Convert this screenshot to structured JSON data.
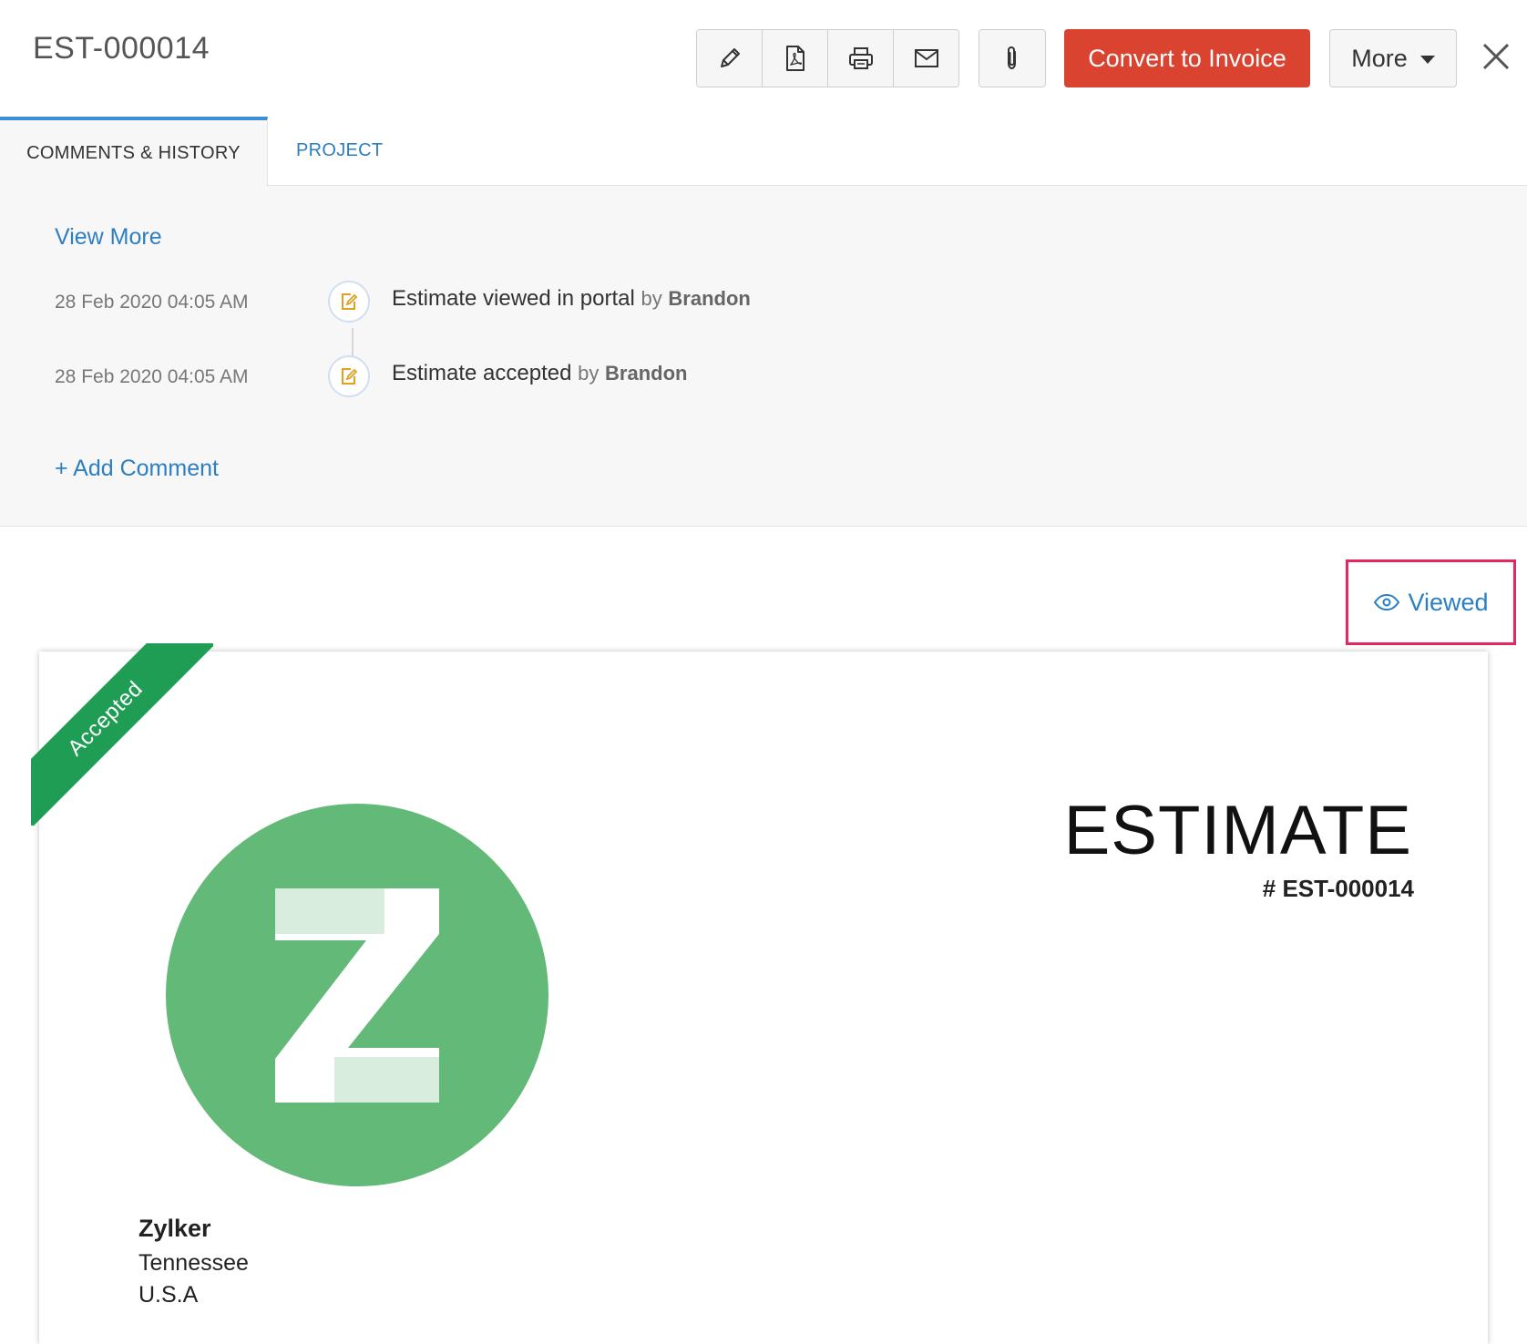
{
  "header": {
    "title": "EST-000014",
    "tool_icons": [
      "edit-icon",
      "pdf-icon",
      "print-icon",
      "mail-icon"
    ],
    "attach_icon": "paperclip-icon",
    "convert_label": "Convert to Invoice",
    "more_label": "More",
    "colors": {
      "primary_action": "#d9432f",
      "link": "#2c7fc2"
    }
  },
  "tabs": [
    {
      "label": "COMMENTS & HISTORY",
      "active": true
    },
    {
      "label": "PROJECT",
      "active": false
    }
  ],
  "history": {
    "view_more": "View More",
    "entries": [
      {
        "date": "28 Feb 2020 04:05 AM",
        "text": "Estimate viewed in portal",
        "by": "by",
        "user": "Brandon"
      },
      {
        "date": "28 Feb 2020 04:05 AM",
        "text": "Estimate accepted",
        "by": "by",
        "user": "Brandon"
      }
    ],
    "add_comment": "+ Add Comment"
  },
  "status": {
    "viewed_label": "Viewed",
    "highlight_color": "#e3275f"
  },
  "document": {
    "ribbon": "Accepted",
    "ribbon_color": "#1f9d55",
    "title": "ESTIMATE",
    "number": "# EST-000014",
    "logo_color": "#62b978",
    "company": {
      "name": "Zylker",
      "lines": [
        "Tennessee",
        "U.S.A"
      ]
    }
  }
}
